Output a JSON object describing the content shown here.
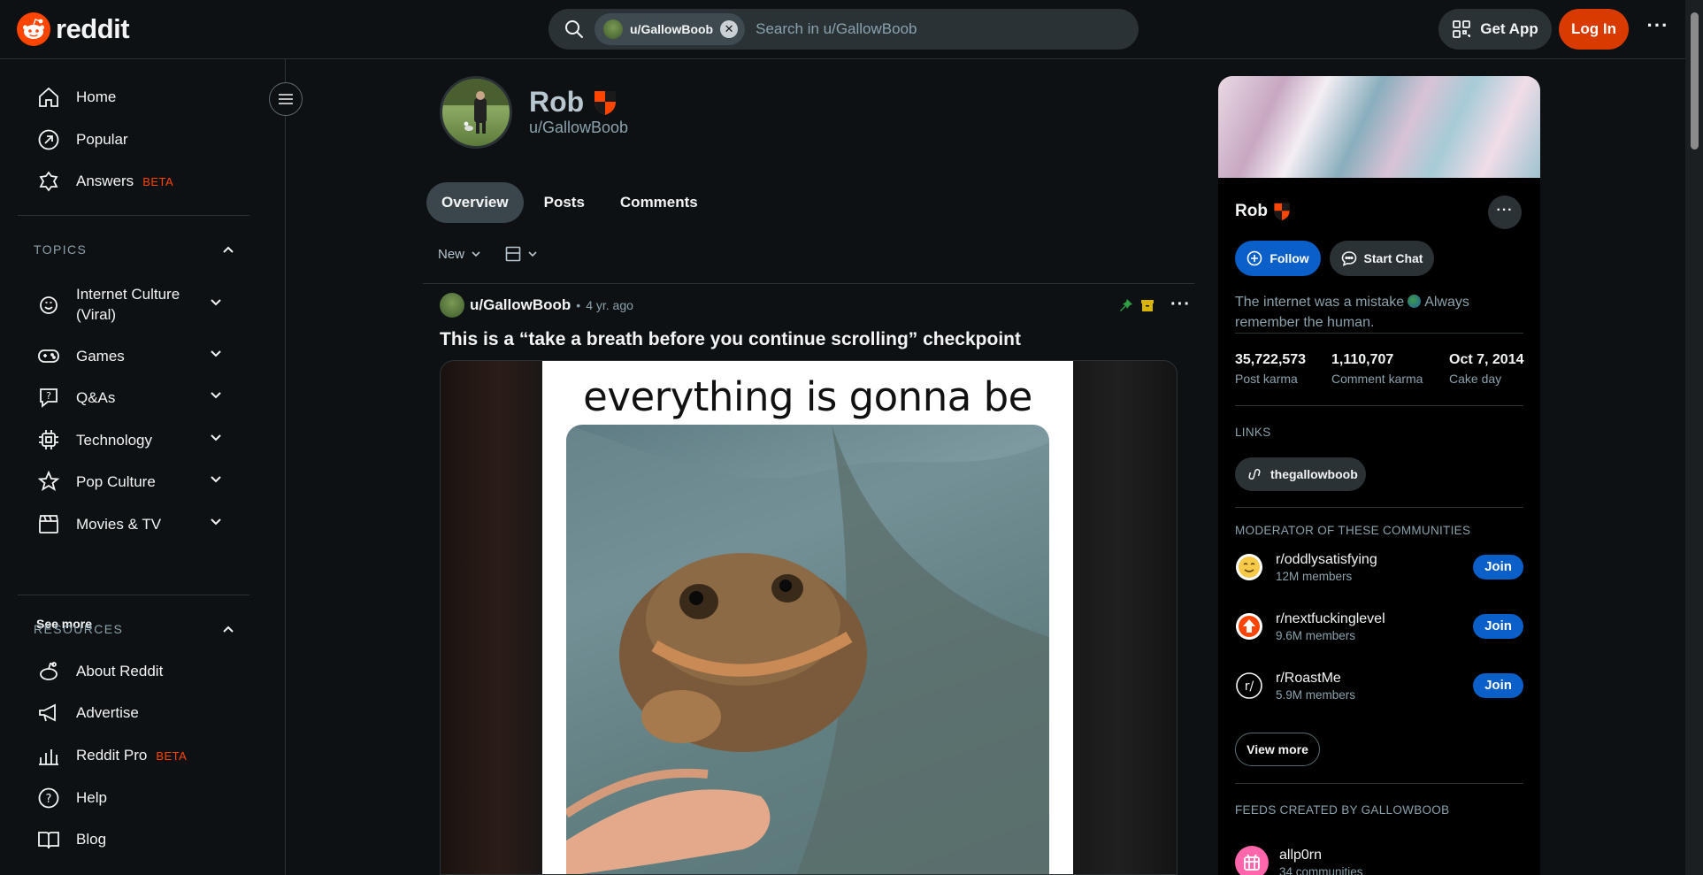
{
  "header": {
    "logo_text": "reddit",
    "search_scope": "u/GallowBoob",
    "search_placeholder": "Search in u/GallowBoob",
    "get_app": "Get App",
    "login": "Log In",
    "more": "···"
  },
  "sidebar": {
    "main": [
      {
        "label": "Home",
        "icon": "home-icon"
      },
      {
        "label": "Popular",
        "icon": "popular-icon"
      },
      {
        "label": "Answers",
        "icon": "answers-icon",
        "badge": "BETA"
      }
    ],
    "topics_heading": "TOPICS",
    "topics": [
      {
        "label": "Internet Culture (Viral)",
        "icon": "internet-culture-icon"
      },
      {
        "label": "Games",
        "icon": "gamepad-icon"
      },
      {
        "label": "Q&As",
        "icon": "qa-icon"
      },
      {
        "label": "Technology",
        "icon": "chip-icon"
      },
      {
        "label": "Pop Culture",
        "icon": "star-icon"
      },
      {
        "label": "Movies & TV",
        "icon": "clapperboard-icon"
      }
    ],
    "see_more": "See more",
    "resources_heading": "RESOURCES",
    "resources": [
      {
        "label": "About Reddit",
        "icon": "reddit-icon"
      },
      {
        "label": "Advertise",
        "icon": "megaphone-icon"
      },
      {
        "label": "Reddit Pro",
        "icon": "bar-chart-icon",
        "badge": "BETA"
      },
      {
        "label": "Help",
        "icon": "help-icon"
      },
      {
        "label": "Blog",
        "icon": "book-icon"
      }
    ]
  },
  "profile": {
    "display_name": "Rob",
    "handle": "u/GallowBoob",
    "tabs": [
      "Overview",
      "Posts",
      "Comments"
    ],
    "active_tab": "Overview",
    "sort": "New"
  },
  "post": {
    "author": "u/GallowBoob",
    "separator": "•",
    "age": "4 yr. ago",
    "title": "This is a “take a breath before you continue scrolling” checkpoint",
    "image_caption": "everything is gonna be fine."
  },
  "card": {
    "name": "Rob",
    "follow": "Follow",
    "start_chat": "Start Chat",
    "bio_part1": "The internet was a mistake",
    "bio_part2": "Always remember the human.",
    "stats": [
      {
        "value": "35,722,573",
        "label": "Post karma"
      },
      {
        "value": "1,110,707",
        "label": "Comment karma"
      },
      {
        "value": "Oct 7, 2014",
        "label": "Cake day"
      }
    ],
    "links_heading": "LINKS",
    "link": "thegallowboob",
    "mod_heading": "MODERATOR OF THESE COMMUNITIES",
    "communities": [
      {
        "name": "r/oddlysatisfying",
        "members": "12M members",
        "join": "Join"
      },
      {
        "name": "r/nextfuckinglevel",
        "members": "9.6M members",
        "join": "Join"
      },
      {
        "name": "r/RoastMe",
        "members": "5.9M members",
        "join": "Join"
      }
    ],
    "view_more": "View more",
    "feeds_heading": "FEEDS CREATED BY GALLOWBOOB",
    "feed": {
      "name": "allp0rn",
      "sub": "34 communities"
    }
  },
  "colors": {
    "accent": "#d93a00",
    "join_blue": "#0a5fc9",
    "background": "#0e1113",
    "beta": "#ff4500"
  }
}
